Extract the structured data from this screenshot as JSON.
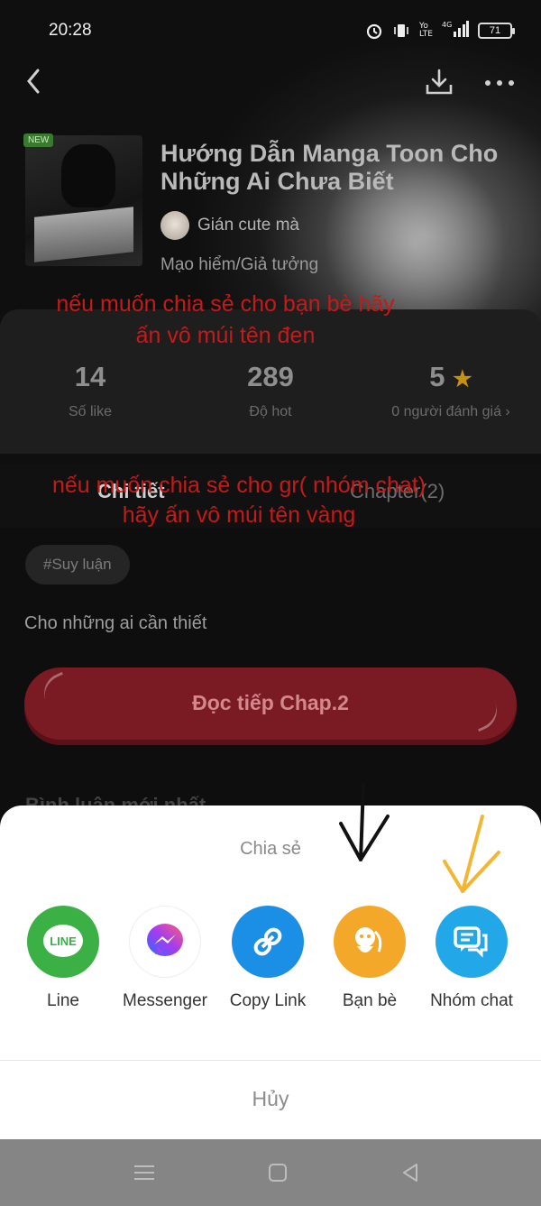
{
  "status": {
    "time": "20:28",
    "battery": "71",
    "network": "4G"
  },
  "manga": {
    "badge": "NEW",
    "title": "Hướng Dẫn Manga Toon Cho Những Ai Chưa Biết",
    "author": "Gián cute mà",
    "genre": "Mạo hiểm/Giả tưởng"
  },
  "annotations": {
    "friends": "nếu muốn chia sẻ cho bạn bè hãy ấn vô múi tên đen",
    "group": "nếu muốn chia sẻ cho gr( nhóm chat) hãy ấn vô múi tên vàng"
  },
  "stats": {
    "likes": {
      "value": "14",
      "label": "Số like"
    },
    "hot": {
      "value": "289",
      "label": "Độ hot"
    },
    "rating": {
      "value": "5",
      "label": "0 người đánh giá"
    }
  },
  "tabs": {
    "detail": "Chi tiết",
    "chapter": "Chapter(2)"
  },
  "tag": "#Suy luận",
  "description": "Cho những ai cần thiết",
  "read_button": "Đọc tiếp Chap.2",
  "comments_heading": "Bình luận mới nhất",
  "share_sheet": {
    "title": "Chia sẻ",
    "items": [
      {
        "label": "Line",
        "icon": "line-icon"
      },
      {
        "label": "Messenger",
        "icon": "messenger-icon"
      },
      {
        "label": "Copy Link",
        "icon": "link-icon"
      },
      {
        "label": "Bạn bè",
        "icon": "friends-icon"
      },
      {
        "label": "Nhóm chat",
        "icon": "group-chat-icon"
      }
    ],
    "cancel": "Hủy"
  },
  "colors": {
    "line": "#3ab045",
    "copy_link": "#1b8ee6",
    "friends": "#f4a82a",
    "group_chat": "#22a8e8",
    "annotation_text": "#c51a1a",
    "arrow_black": "#111111",
    "arrow_yellow": "#f2b632"
  }
}
